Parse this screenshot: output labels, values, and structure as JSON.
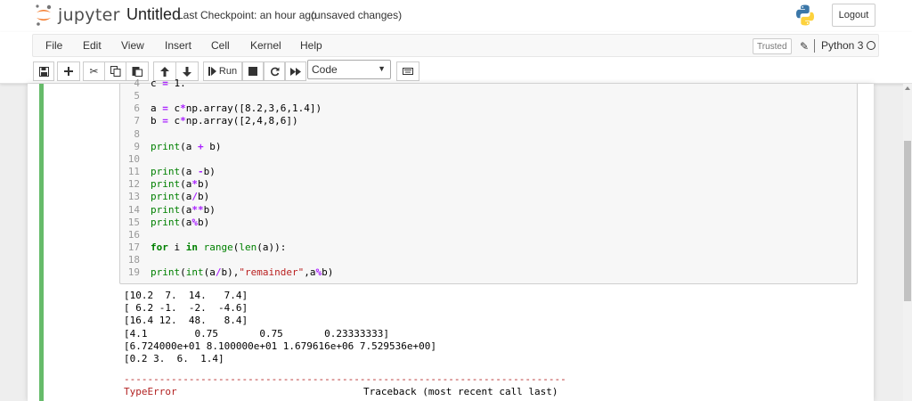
{
  "header": {
    "logo_text": "jupyter",
    "notebook_title": "Untitled",
    "checkpoint": "Last Checkpoint: an hour ago",
    "save_status": "(unsaved changes)",
    "logout_label": "Logout"
  },
  "menu": {
    "items": [
      "File",
      "Edit",
      "View",
      "Insert",
      "Cell",
      "Kernel",
      "Help"
    ],
    "trusted_label": "Trusted",
    "kernel_name": "Python 3"
  },
  "toolbar": {
    "run_label": "Run",
    "cell_type": "Code",
    "cell_type_options": [
      "Code"
    ]
  },
  "code_lines": [
    {
      "n": "4",
      "text": "c = 1."
    },
    {
      "n": "5",
      "text": ""
    },
    {
      "n": "6",
      "text": "a = c*np.array([8.2,3,6,1.4])"
    },
    {
      "n": "7",
      "text": "b = c*np.array([2,4,8,6])"
    },
    {
      "n": "8",
      "text": ""
    },
    {
      "n": "9",
      "text": "print(a + b)"
    },
    {
      "n": "10",
      "text": ""
    },
    {
      "n": "11",
      "text": "print(a -b)"
    },
    {
      "n": "12",
      "text": "print(a*b)"
    },
    {
      "n": "13",
      "text": "print(a/b)"
    },
    {
      "n": "14",
      "text": "print(a**b)"
    },
    {
      "n": "15",
      "text": "print(a%b)"
    },
    {
      "n": "16",
      "text": ""
    },
    {
      "n": "17",
      "text": "for i in range(len(a)):"
    },
    {
      "n": "18",
      "text": ""
    },
    {
      "n": "19",
      "text": "print(int(a/b),\"remainder\",a%b)"
    }
  ],
  "output_lines": [
    "[10.2  7.  14.   7.4]",
    "[ 6.2 -1.  -2.  -4.6]",
    "[16.4 12.  48.   8.4]",
    "[4.1        0.75       0.75       0.23333333]",
    "[6.724000e+01 8.100000e+01 1.679616e+06 7.529536e+00]",
    "[0.2 3.  6.  1.4]",
    ""
  ],
  "error": {
    "separator": "---------------------------------------------------------------------------",
    "name": "TypeError",
    "traceback": "Traceback (most recent call last)"
  },
  "colors": {
    "cell_bar": "#66bb6a",
    "error": "#b22222",
    "keyword": "#008000",
    "string": "#ba2121",
    "operator": "#aa22ff"
  }
}
